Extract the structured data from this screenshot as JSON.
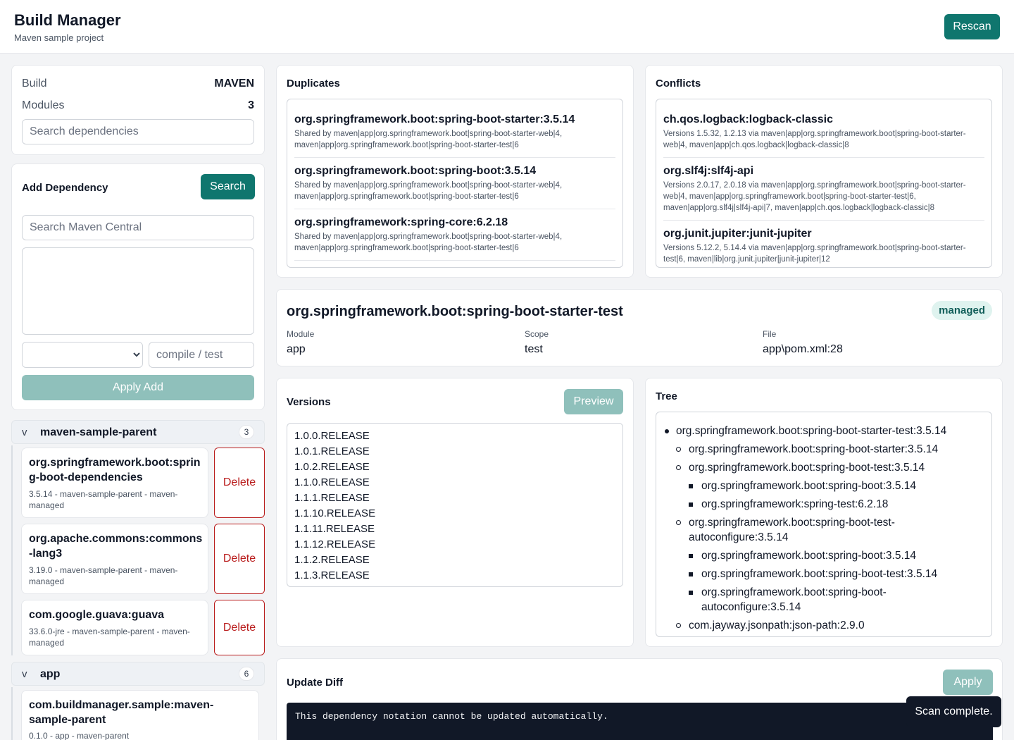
{
  "header": {
    "title": "Build Manager",
    "subtitle": "Maven sample project",
    "rescan_label": "Rescan"
  },
  "summary": {
    "build_label": "Build",
    "build_value": "MAVEN",
    "modules_label": "Modules",
    "modules_value": "3",
    "search_placeholder": "Search dependencies"
  },
  "add_dependency": {
    "title": "Add Dependency",
    "search_button": "Search",
    "search_placeholder": "Search Maven Central",
    "scope_placeholder": "compile / test",
    "apply_label": "Apply Add"
  },
  "groups": [
    {
      "chevron": "v",
      "name": "maven-sample-parent",
      "count": "3",
      "items": [
        {
          "name": "org.springframework.boot:spring-boot-dependencies",
          "meta": "3.5.14 - maven-sample-parent - maven-managed",
          "delete_label": "Delete"
        },
        {
          "name": "org.apache.commons:commons-lang3",
          "meta": "3.19.0 - maven-sample-parent - maven-managed",
          "delete_label": "Delete"
        },
        {
          "name": "com.google.guava:guava",
          "meta": "33.6.0-jre - maven-sample-parent - maven-managed",
          "delete_label": "Delete"
        }
      ]
    },
    {
      "chevron": "v",
      "name": "app",
      "count": "6",
      "items": [
        {
          "name": "com.buildmanager.sample:maven-sample-parent",
          "meta": "0.1.0 - app - maven-parent"
        }
      ]
    }
  ],
  "duplicates": {
    "title": "Duplicates",
    "items": [
      {
        "name": "org.springframework.boot:spring-boot-starter:3.5.14",
        "desc": "Shared by maven|app|org.springframework.boot|spring-boot-starter-web|4, maven|app|org.springframework.boot|spring-boot-starter-test|6"
      },
      {
        "name": "org.springframework.boot:spring-boot:3.5.14",
        "desc": "Shared by maven|app|org.springframework.boot|spring-boot-starter-web|4, maven|app|org.springframework.boot|spring-boot-starter-test|6"
      },
      {
        "name": "org.springframework:spring-core:6.2.18",
        "desc": "Shared by maven|app|org.springframework.boot|spring-boot-starter-web|4, maven|app|org.springframework.boot|spring-boot-starter-test|6"
      }
    ]
  },
  "conflicts": {
    "title": "Conflicts",
    "items": [
      {
        "name": "ch.qos.logback:logback-classic",
        "desc": "Versions 1.5.32, 1.2.13 via maven|app|org.springframework.boot|spring-boot-starter-web|4, maven|app|ch.qos.logback|logback-classic|8"
      },
      {
        "name": "org.slf4j:slf4j-api",
        "desc": "Versions 2.0.17, 2.0.18 via maven|app|org.springframework.boot|spring-boot-starter-web|4, maven|app|org.springframework.boot|spring-boot-starter-test|6, maven|app|org.slf4j|slf4j-api|7, maven|app|ch.qos.logback|logback-classic|8"
      },
      {
        "name": "org.junit.jupiter:junit-jupiter",
        "desc": "Versions 5.12.2, 5.14.4 via maven|app|org.springframework.boot|spring-boot-starter-test|6, maven|lib|org.junit.jupiter|junit-jupiter|12"
      }
    ]
  },
  "detail": {
    "title": "org.springframework.boot:spring-boot-starter-test",
    "badge": "managed",
    "module_label": "Module",
    "module_value": "app",
    "scope_label": "Scope",
    "scope_value": "test",
    "file_label": "File",
    "file_value": "app\\pom.xml:28"
  },
  "versions": {
    "title": "Versions",
    "preview_label": "Preview",
    "items": [
      "1.0.0.RELEASE",
      "1.0.1.RELEASE",
      "1.0.2.RELEASE",
      "1.1.0.RELEASE",
      "1.1.1.RELEASE",
      "1.1.10.RELEASE",
      "1.1.11.RELEASE",
      "1.1.12.RELEASE",
      "1.1.2.RELEASE",
      "1.1.3.RELEASE"
    ]
  },
  "tree": {
    "title": "Tree",
    "nodes": [
      "org.springframework.boot:spring-boot-starter-test:3.5.14",
      "org.springframework.boot:spring-boot-starter:3.5.14",
      "org.springframework.boot:spring-boot-test:3.5.14",
      "org.springframework.boot:spring-boot:3.5.14",
      "org.springframework:spring-test:6.2.18",
      "org.springframework.boot:spring-boot-test-autoconfigure:3.5.14",
      "org.springframework.boot:spring-boot:3.5.14",
      "org.springframework.boot:spring-boot-test:3.5.14",
      "org.springframework.boot:spring-boot-autoconfigure:3.5.14",
      "com.jayway.jsonpath:json-path:2.9.0"
    ]
  },
  "update_diff": {
    "title": "Update Diff",
    "apply_label": "Apply",
    "message": "This dependency notation cannot be updated automatically."
  },
  "toast": {
    "message": "Scan complete."
  },
  "colors": {
    "accent": "#0f766e",
    "danger": "#b91c1c",
    "badge_bg": "#dff3ef"
  }
}
